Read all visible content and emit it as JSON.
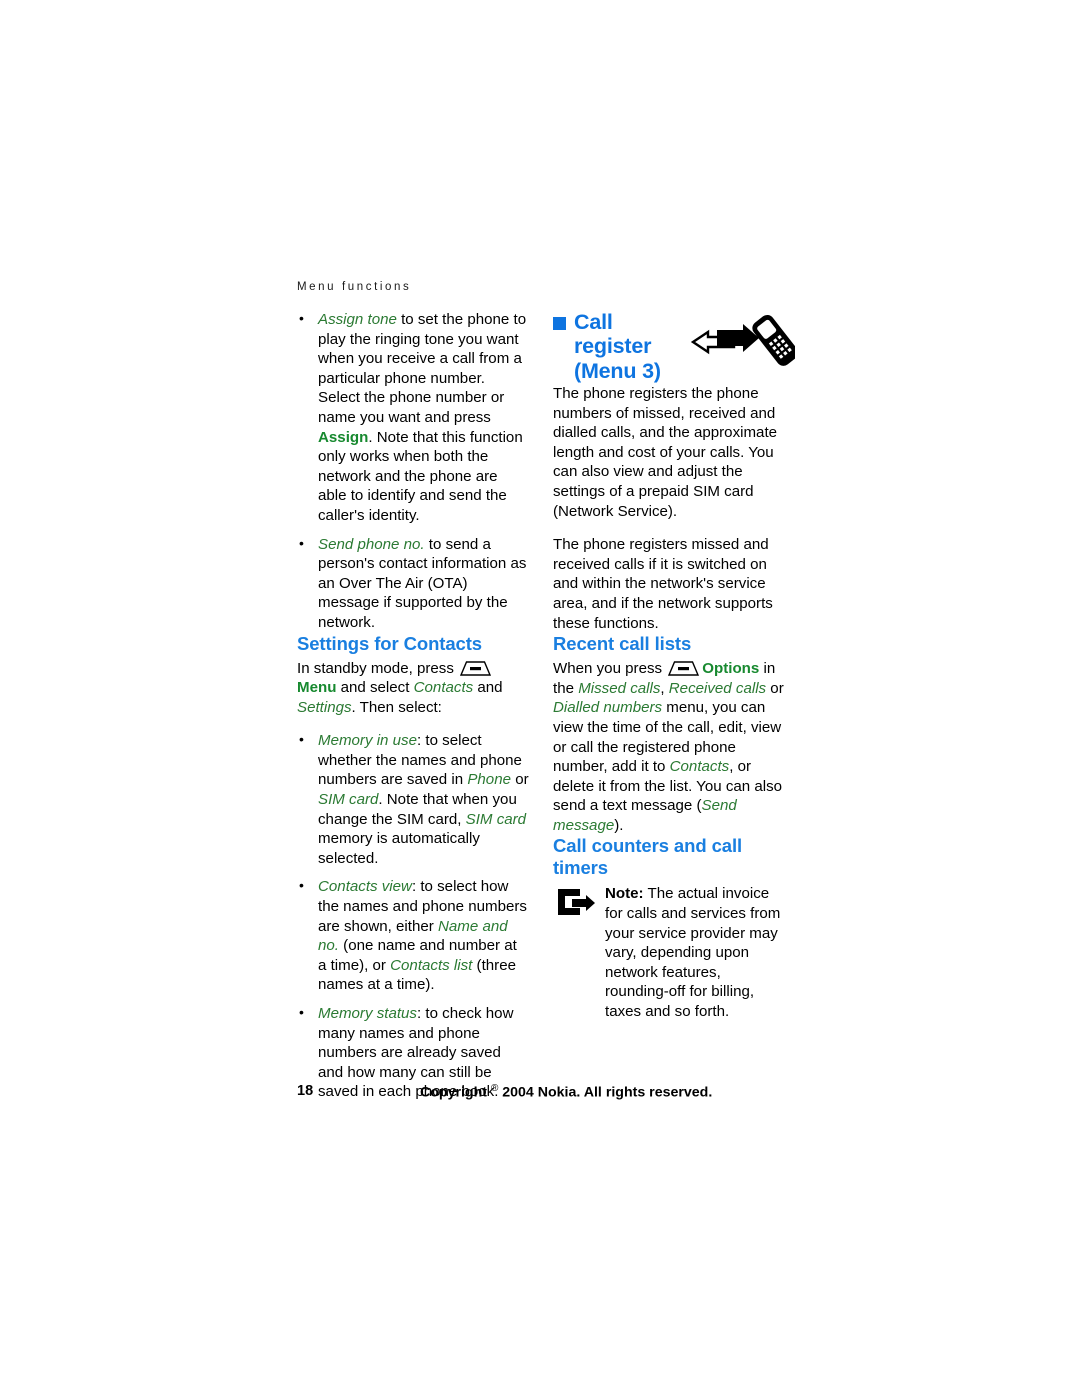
{
  "document": {
    "running_header": "Menu  functions",
    "page_number": "18",
    "copyright": "Copyright © 2004 Nokia. All rights reserved.",
    "copyright_prefix": "Copyright ",
    "copyright_symbol": "®",
    "copyright_suffix": " 2004 Nokia. All rights reserved."
  },
  "colors": {
    "heading_blue": "#1a7fe0",
    "chapter_blue": "#0e74e0",
    "italic_green": "#2b7a33",
    "bold_green": "#17892f",
    "body_black": "#000000",
    "header_gray": "#1a1a1a"
  },
  "left_column": {
    "bullets": [
      {
        "term": "Assign tone",
        "text_1": " to set the phone to play the ringing tone you want when you receive a call from a particular phone number. Select the phone number or name you want and press ",
        "bold_key": "Assign",
        "text_2": ". Note that this function only works when both the network and the phone are able to identify and send the caller's identity."
      },
      {
        "term": "Send phone no.",
        "text_1": " to send a person's contact information as an Over The Air (OTA) message if supported by the network."
      }
    ],
    "section": {
      "heading": "Settings for Contacts",
      "intro_1": "In standby mode, press ",
      "intro_softkey_label": "Menu",
      "intro_2": " and select ",
      "intro_italic_1": "Contacts",
      "intro_3": " and ",
      "intro_italic_2": "Settings",
      "intro_4": ". Then select:",
      "bullets": [
        {
          "term": "Memory in use",
          "text_1": ": to select whether the names and phone numbers are saved in ",
          "italic_2": "Phone",
          "text_2": " or ",
          "italic_3": "SIM card",
          "text_3": ". Note that when you change the SIM card, ",
          "italic_4": "SIM card",
          "text_4": " memory is automatically selected."
        },
        {
          "term": "Contacts view",
          "text_1": ": to select how the names and phone numbers are shown, either ",
          "italic_2": "Name and no.",
          "text_2": " (one name and number at a time), or ",
          "italic_3": "Contacts list",
          "text_3": " (three names at a time)."
        },
        {
          "term": "Memory status",
          "text_1": ": to check how many names and phone numbers are already saved and how many can still be saved in each phone book."
        }
      ]
    }
  },
  "right_column": {
    "chapter": {
      "title_line_1": "Call",
      "title_line_2": "register",
      "title_line_3": "(Menu 3)",
      "artwork_name": "call-register-phone-arrows-illustration"
    },
    "paragraphs": [
      "The phone registers the phone numbers of missed, received and dialled calls, and the approximate length and cost of your calls. You can also view and adjust the settings of a prepaid SIM card (Network Service).",
      "The phone registers missed and received calls if it is switched on and within the network's service area, and if the network supports these functions."
    ],
    "recent_call_lists": {
      "heading": "Recent call lists",
      "text_1": "When you press ",
      "softkey_label": "Options",
      "text_2": " in the ",
      "italic_1": "Missed calls",
      "text_3": ", ",
      "italic_2": "Received calls",
      "text_4": " or ",
      "italic_3": "Dialled numbers",
      "text_5": " menu, you can view the time of the call, edit, view or call the registered phone number, add it to ",
      "italic_4": "Contacts",
      "text_6": ", or delete it from the list. You can also send a text message (",
      "italic_5": "Send message",
      "text_7": ")."
    },
    "call_counters": {
      "heading": "Call counters and call timers",
      "note_icon_name": "note-hand-pointer-icon",
      "note_label": "Note:",
      "note_text": " The actual invoice for calls and services from your service provider may vary, depending upon network features, rounding-off for billing, taxes and so forth."
    }
  }
}
